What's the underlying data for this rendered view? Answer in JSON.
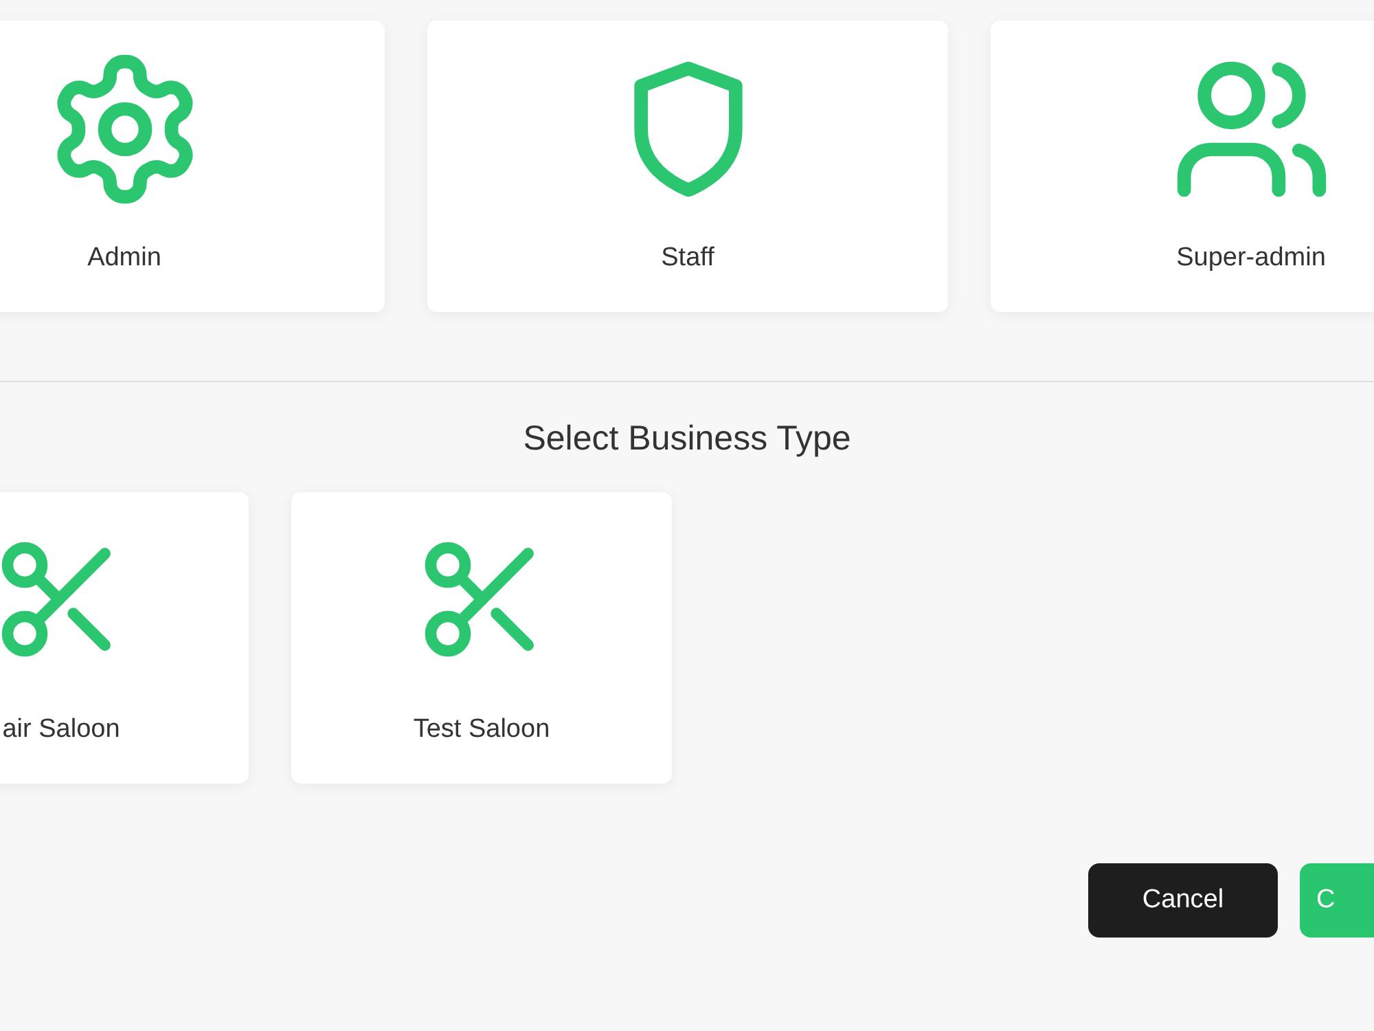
{
  "roles": [
    {
      "label": "Admin",
      "kind": "gear"
    },
    {
      "label": "Staff",
      "kind": "shield"
    },
    {
      "label": "Super-admin",
      "kind": "users"
    }
  ],
  "business_section": {
    "title": "Select Business Type"
  },
  "business_types": [
    {
      "label": "air Saloon",
      "kind": "scissors"
    },
    {
      "label": "Test Saloon",
      "kind": "scissors"
    }
  ],
  "buttons": [
    {
      "label": "Cancel",
      "kind": "secondary"
    },
    {
      "label": "C",
      "kind": "primary"
    }
  ]
}
